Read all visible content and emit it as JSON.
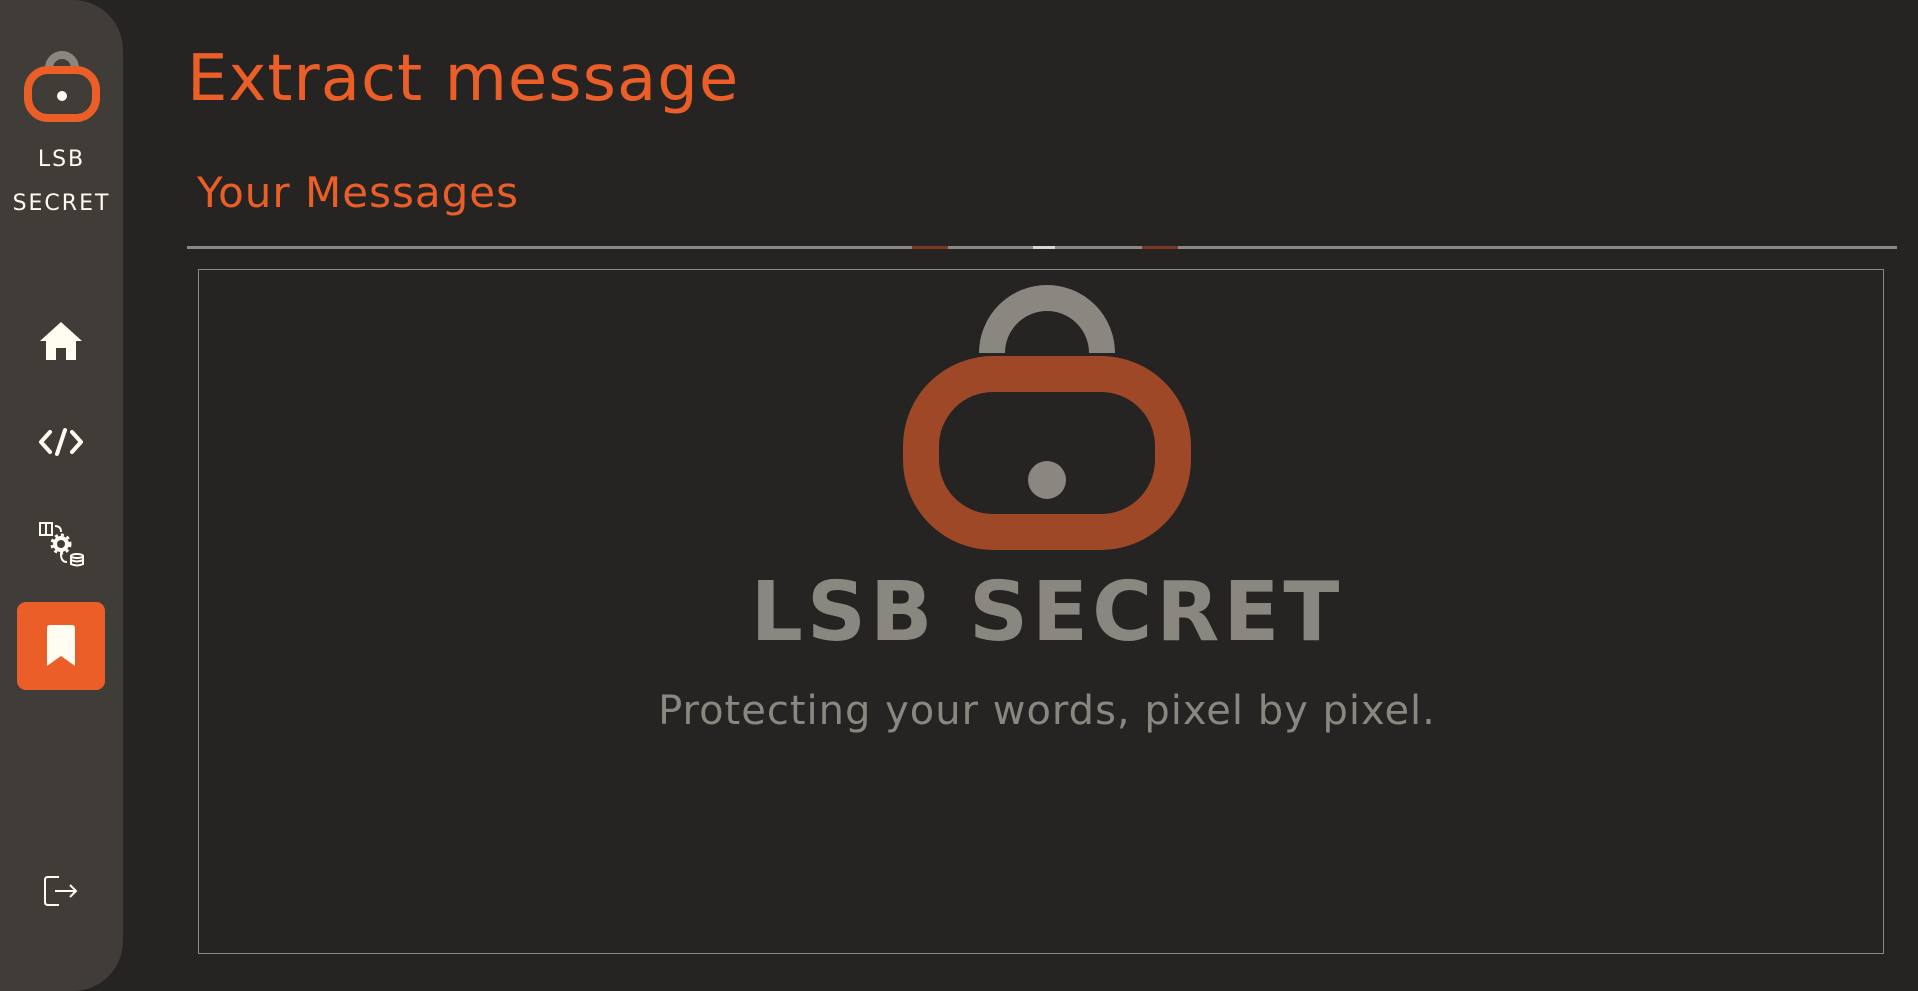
{
  "app": {
    "brand_name": "LSB\nSECRET"
  },
  "sidebar": {
    "items": [
      {
        "name": "home",
        "icon": "home-icon",
        "active": false
      },
      {
        "name": "encode",
        "icon": "code-icon",
        "active": false
      },
      {
        "name": "process",
        "icon": "data-transfer-settings-icon",
        "active": false
      },
      {
        "name": "messages",
        "icon": "bookmark-icon",
        "active": true
      }
    ],
    "logout_icon": "logout-icon"
  },
  "page": {
    "title": "Extract message",
    "section_title": "Your Messages"
  },
  "watermark": {
    "title": "LSB SECRET",
    "tagline": "Protecting your words, pixel by pixel."
  },
  "colors": {
    "accent": "#eb5e28",
    "sidebar_bg": "#403d39",
    "page_bg": "#252422",
    "text_light": "#fffcf2",
    "muted": "#8a8780"
  }
}
